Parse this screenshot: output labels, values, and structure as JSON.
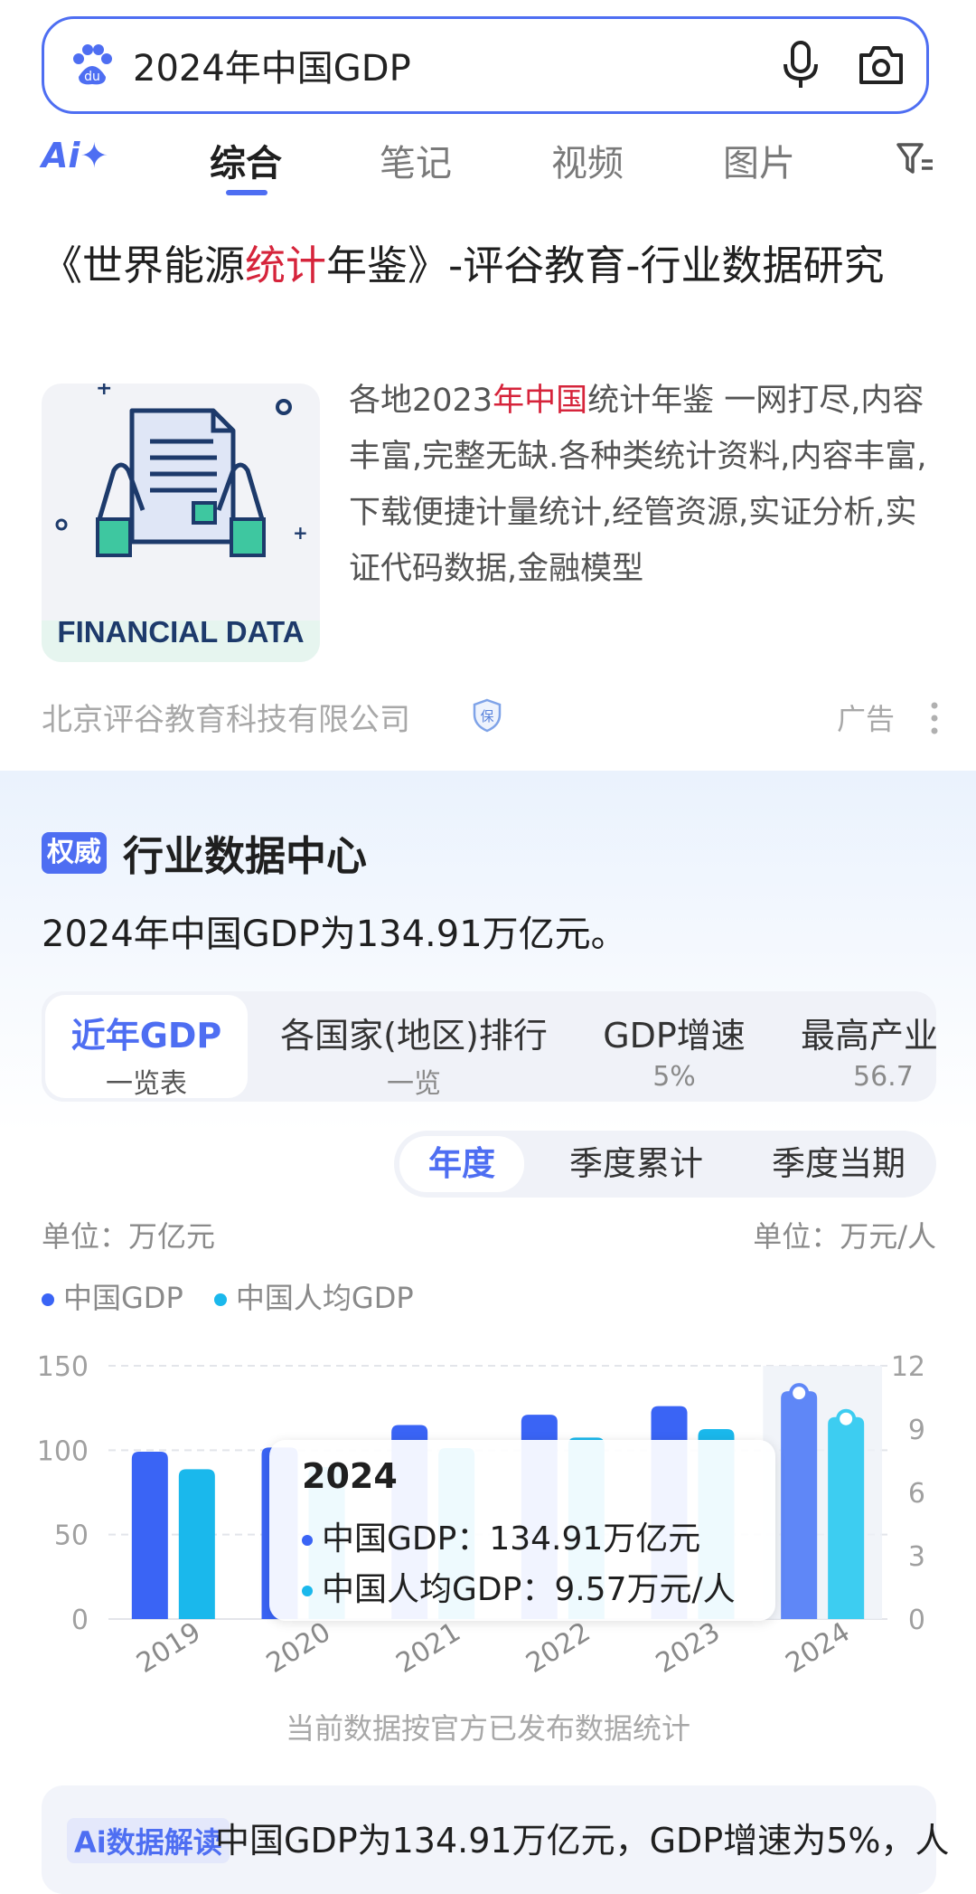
{
  "search": {
    "query": "2024年中国GDP"
  },
  "tabs": {
    "ai_label": "Ai✦",
    "items": [
      "综合",
      "笔记",
      "视频",
      "图片"
    ]
  },
  "ad": {
    "title_part1": "《世界能源",
    "title_highlight": "统计",
    "title_part2": "年鉴》-评谷教育-行业数据研究",
    "desc_part1": "各地2023",
    "desc_highlight": "年中国",
    "desc_part2": "统计年鉴 一网打尽,内容丰富,完整无缺.各种类统计资料,内容丰富,下载便捷计量统计,经管资源,实证分析,实证代码数据,金融模型",
    "image_caption": "FINANCIAL DATA",
    "source": "北京评谷教育科技有限公司",
    "shield_label": "保",
    "label": "广告"
  },
  "data_center": {
    "badge": "权威",
    "title": "行业数据中心",
    "summary": "2024年中国GDP为134.91万亿元。",
    "categories": [
      {
        "l1": "近年GDP",
        "l2": "一览表"
      },
      {
        "l1": "各国家(地区)排行",
        "l2": "一览"
      },
      {
        "l1": "GDP增速",
        "l2": "5%"
      },
      {
        "l1": "最高产业",
        "l2": "56.7"
      }
    ],
    "segments": [
      "年度",
      "季度累计",
      "季度当期"
    ],
    "unit_left": "单位：万亿元",
    "unit_right": "单位：万元/人",
    "legend": [
      "中国GDP",
      "中国人均GDP"
    ],
    "tooltip": {
      "year": "2024",
      "row1": "中国GDP：134.91万亿元",
      "row2": "中国人均GDP：9.57万元/人"
    },
    "footnote": "当前数据按官方已发布数据统计",
    "ai_tag": "Ai数据解读",
    "ai_text": "中国GDP为134.91万亿元，GDP增速为5%，人"
  },
  "chart_data": {
    "type": "bar",
    "categories": [
      "2019",
      "2020",
      "2021",
      "2022",
      "2023",
      "2024"
    ],
    "series": [
      {
        "name": "中国GDP",
        "axis": "left",
        "color": "#3a64f5",
        "values": [
          99.1,
          101.6,
          114.9,
          121.0,
          126.1,
          134.91
        ]
      },
      {
        "name": "中国人均GDP",
        "axis": "right",
        "color": "#1ab8ec",
        "values": [
          7.1,
          7.2,
          8.1,
          8.6,
          9.0,
          9.57
        ]
      }
    ],
    "left_ticks": [
      "150",
      "100",
      "50",
      "0"
    ],
    "right_ticks": [
      "12",
      "9",
      "6",
      "3",
      "0"
    ],
    "ylim_left": [
      0,
      150
    ],
    "ylim_right": [
      0,
      12
    ],
    "highlight": "2024",
    "grid": true
  }
}
